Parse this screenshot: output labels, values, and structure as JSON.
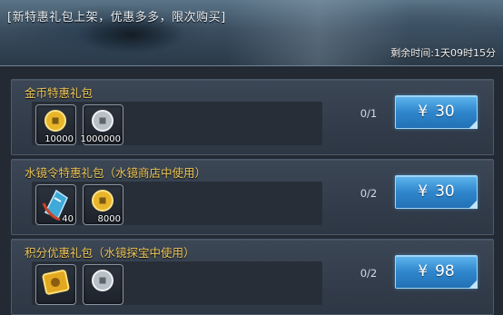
{
  "banner": {
    "title": "[新特惠礼包上架，优惠多多，限次购买]",
    "countdown": "剩余时间:1天09时15分"
  },
  "packs": [
    {
      "title": "金币特惠礼包",
      "items": [
        {
          "icon": "gold-coin-icon",
          "qty": "10000"
        },
        {
          "icon": "silver-coin-icon",
          "qty": "1000000"
        }
      ],
      "limit": "0/1",
      "currency": "¥",
      "price": "30"
    },
    {
      "title": "水镜令特惠礼包（水镜商店中使用）",
      "items": [
        {
          "icon": "water-mirror-token-icon",
          "qty": "40"
        },
        {
          "icon": "gold-coin-icon",
          "qty": "8000"
        }
      ],
      "limit": "0/2",
      "currency": "¥",
      "price": "30"
    },
    {
      "title": "积分优惠礼包（水镜探宝中使用）",
      "items": [
        {
          "icon": "gold-points-ticket-icon",
          "qty": ""
        },
        {
          "icon": "silver-coin-icon",
          "qty": ""
        }
      ],
      "limit": "0/2",
      "currency": "¥",
      "price": "98"
    }
  ]
}
